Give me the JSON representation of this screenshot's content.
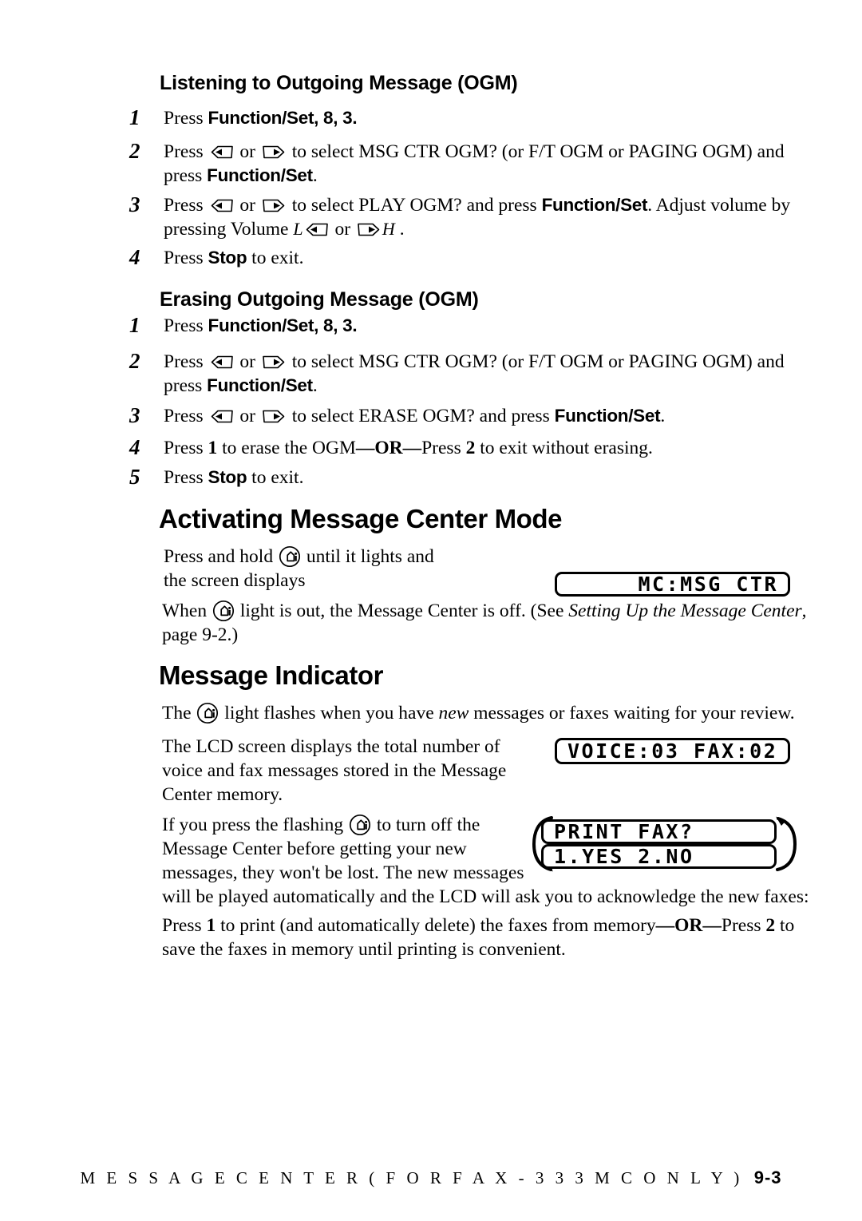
{
  "document": {
    "page_label": "9-3",
    "footer_text": "M E S S A G E   C E N T E R   ( F O R   F A X - 3 3 3 M C   O N L Y )"
  },
  "sections": {
    "listening": {
      "heading": "Listening to Outgoing Message (OGM)",
      "steps": [
        {
          "num": "1",
          "text_a": "Press ",
          "bold_a": "Function/Set",
          "text_b": ", 8, 3."
        },
        {
          "num": "2",
          "text_a": "Press ",
          "text_b": " or ",
          "text_c": " to select MSG CTR OGM? (or F/T OGM or PAGING OGM) and press ",
          "bold_b": "Function/Set",
          "text_d": "."
        },
        {
          "num": "3",
          "text_a": "Press ",
          "text_b": " or ",
          "text_c": " to select PLAY OGM? and press ",
          "bold_b": "Function/Set",
          "text_d": ". Adjust volume by pressing Volume ",
          "vol_low": "L",
          "text_e": " or ",
          "vol_high": "H",
          "text_f": " ."
        },
        {
          "num": "4",
          "text_a": "Press ",
          "bold_a": "Stop",
          "text_b": " to exit."
        }
      ]
    },
    "erasing": {
      "heading": "Erasing Outgoing Message (OGM)",
      "steps": [
        {
          "num": "1",
          "text_a": "Press ",
          "bold_a": "Function/Set",
          "text_b": ", 8, 3."
        },
        {
          "num": "2",
          "text_a": "Press ",
          "text_b": " or ",
          "text_c": " to select MSG CTR OGM? (or F/T OGM or PAGING OGM) and press ",
          "bold_b": "Function/Set",
          "text_d": "."
        },
        {
          "num": "3",
          "text_a": "Press ",
          "text_b": " or ",
          "text_c": " to select ERASE OGM? and press ",
          "bold_b": "Function/Set",
          "text_d": "."
        },
        {
          "num": "4",
          "text_a": "Press ",
          "bold_a": "1",
          "text_b": " to erase the OGM",
          "bold_b": "—OR—",
          "text_c": "Press ",
          "bold_c": "2",
          "text_d": " to exit without erasing."
        },
        {
          "num": "5",
          "text_a": "Press ",
          "bold_a": "Stop",
          "text_b": " to exit."
        }
      ]
    },
    "activating": {
      "heading": "Activating Message Center Mode",
      "para1_a": "Press and hold ",
      "para1_b": " until it lights and",
      "para1_c": "the screen displays",
      "para2_a": "When ",
      "para2_b": " light is out, the Message Center is off. (See ",
      "para2_italic": "Setting Up the Message Center",
      "para2_c": ", page 9-2.)",
      "lcd": "MC:MSG CTR"
    },
    "message_indicator": {
      "heading": "Message Indicator",
      "para1_a": "The ",
      "para1_b": " light flashes when you have ",
      "para1_italic": "new",
      "para1_c": " messages or faxes waiting for your review.",
      "para2": "The LCD screen displays the total number of voice and fax messages stored in the Message Center memory.",
      "lcd_counts": "VOICE:03 FAX:02",
      "para3_a": "If you press the flashing ",
      "para3_b": " to turn off the Message Center before getting your new messages, they won't be lost. The new messages",
      "para3_c": "will be played automatically and the LCD will ask you to acknowledge the new faxes:",
      "lcd_prompt": "PRINT FAX?",
      "lcd_options": "1.YES 2.NO",
      "para4_a": "Press ",
      "para4_bold1": "1",
      "para4_b": " to print (and automatically delete) the faxes from memory",
      "para4_bold2": "—OR—",
      "para4_c": "Press ",
      "para4_bold3": "2",
      "para4_d": " to save the faxes in memory until printing is convenient."
    }
  },
  "icons": {
    "left_arrow_key": "left-arrow-key-icon",
    "right_arrow_key": "right-arrow-key-icon",
    "message_center_button": "message-center-button-icon",
    "loop_arrow": "loop-arrow-icon"
  },
  "colors": {
    "ink": "#000000",
    "paper": "#ffffff"
  }
}
